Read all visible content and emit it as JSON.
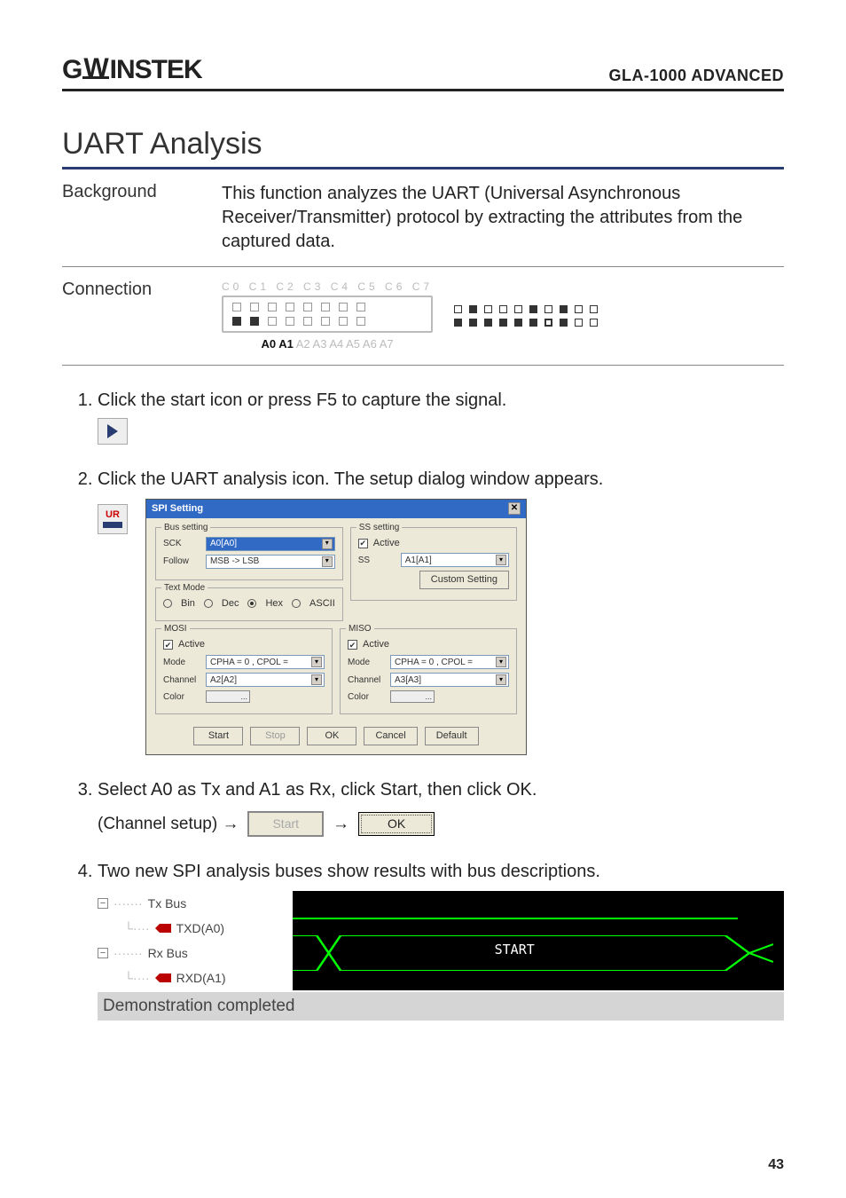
{
  "header": {
    "brand": "GWINSTEK",
    "doc_title": "GLA-1000 ADVANCED"
  },
  "section_title": "UART Analysis",
  "rows": {
    "background": {
      "label": "Background",
      "text": "This function analyzes the UART (Universal Asynchronous Receiver/Transmitter) protocol by extracting the attributes from the captured data."
    },
    "connection": {
      "label": "Connection",
      "top_labels": "C0 C1 C2 C3 C4 C5 C6 C7",
      "bottom_prefix": "A0 A1",
      "bottom_rest": " A2 A3 A4 A5 A6 A7"
    }
  },
  "steps": {
    "s1": "Click the start icon or press F5 to capture the signal.",
    "s2": "Click the UART analysis icon. The setup dialog window appears.",
    "s3": "Select A0 as Tx and A1 as Rx, click Start, then click OK.",
    "s3_hint": "(Channel setup) →",
    "s4": "Two new SPI analysis buses show results with bus descriptions."
  },
  "dialog": {
    "title": "SPI Setting",
    "bus": {
      "legend": "Bus setting",
      "sck_label": "SCK",
      "sck_value": "A0[A0]",
      "follow_label": "Follow",
      "follow_value": "MSB -> LSB"
    },
    "ss": {
      "legend": "SS setting",
      "active": "Active",
      "ss_label": "SS",
      "ss_value": "A1[A1]",
      "custom_btn": "Custom Setting"
    },
    "textmode": {
      "legend": "Text Mode",
      "opts": [
        "Bin",
        "Dec",
        "Hex",
        "ASCII"
      ]
    },
    "mosi": {
      "legend": "MOSI",
      "active": "Active",
      "mode_label": "Mode",
      "mode_value": "CPHA = 0 , CPOL =",
      "channel_label": "Channel",
      "channel_value": "A2[A2]",
      "color_label": "Color",
      "color_btn": "..."
    },
    "miso": {
      "legend": "MISO",
      "active": "Active",
      "mode_label": "Mode",
      "mode_value": "CPHA = 0 , CPOL =",
      "channel_label": "Channel",
      "channel_value": "A3[A3]",
      "color_label": "Color",
      "color_btn": "..."
    },
    "btns": {
      "start": "Start",
      "stop": "Stop",
      "ok": "OK",
      "cancel": "Cancel",
      "default": "Default"
    }
  },
  "inline_btns": {
    "start": "Start",
    "ok": "OK",
    "arrow": "→"
  },
  "wave": {
    "tree": {
      "tx_bus": "Tx Bus",
      "txd": "TXD(A0)",
      "rx_bus": "Rx Bus",
      "rxd": "RXD(A1)"
    },
    "label_start": "START"
  },
  "ur_label": "UR",
  "demo_bar": "Demonstration completed",
  "pagenum": "43"
}
